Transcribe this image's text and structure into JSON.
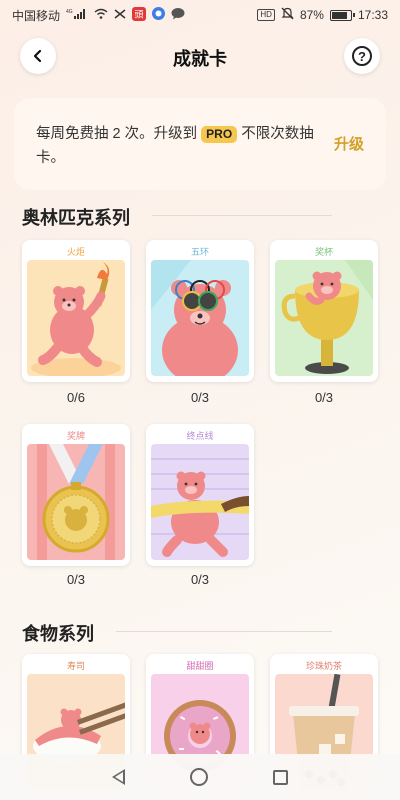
{
  "status_bar": {
    "carrier": "中国移动",
    "network": "4G",
    "battery": "87%",
    "battery_level": 0.87,
    "time": "17:33",
    "icons": [
      "signal-icon",
      "wifi-icon",
      "notification-icon",
      "app-icon",
      "chat-icon",
      "hd-icon",
      "mute-icon",
      "battery-icon"
    ],
    "hd": "HD"
  },
  "header": {
    "title": "成就卡",
    "back_icon": "chevron-left-icon",
    "help_icon": "question-icon",
    "help_glyph": "?"
  },
  "promo": {
    "text_before": "每周免费抽 2 次。升级到 ",
    "badge": "PRO",
    "text_after": " 不限次数抽卡。",
    "upgrade": "升级",
    "accent": "#d4a02a",
    "badge_color": "#f6c64d"
  },
  "sections": [
    {
      "title": "奥林匹克系列",
      "cards": [
        {
          "label": "火炬",
          "count": "0/6",
          "label_color": "#f0a640",
          "bg": "#fde3b8"
        },
        {
          "label": "五环",
          "count": "0/3",
          "label_color": "#6ab6d8",
          "bg": "#c9edf4"
        },
        {
          "label": "奖杯",
          "count": "0/3",
          "label_color": "#78c07a",
          "bg": "#d6f0cd"
        },
        {
          "label": "奖牌",
          "count": "0/3",
          "label_color": "#e88a8a",
          "bg": "#f7b6b4"
        },
        {
          "label": "终点线",
          "count": "0/3",
          "label_color": "#b58ad8",
          "bg": "#e6d9f6"
        }
      ]
    },
    {
      "title": "食物系列",
      "cards": [
        {
          "label": "寿司",
          "label_color": "#d88b5a",
          "bg": "#fbe1c8"
        },
        {
          "label": "甜甜圈",
          "label_color": "#d467b0",
          "bg": "#f8d0ea"
        },
        {
          "label": "珍珠奶茶",
          "label_color": "#e08070",
          "bg": "#fbd9cf"
        }
      ]
    }
  ],
  "navbar": {
    "back": "nav-back-icon",
    "home": "nav-home-icon",
    "recent": "nav-recent-icon"
  }
}
